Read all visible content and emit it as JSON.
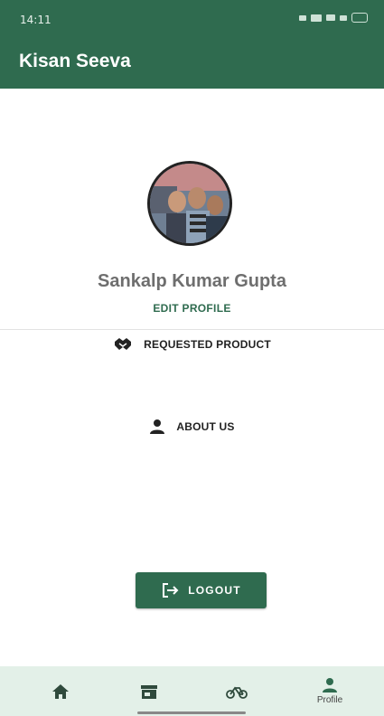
{
  "status_bar": {
    "time": "14:11"
  },
  "app_bar": {
    "title": "Kisan Seeva"
  },
  "profile": {
    "name": "Sankalp Kumar Gupta",
    "edit_label": "EDIT PROFILE"
  },
  "menu": [
    {
      "label": "REQUESTED PRODUCT",
      "icon": "handshake-icon"
    },
    {
      "label": "ABOUT US",
      "icon": "person-icon"
    }
  ],
  "logout": {
    "label": "LOGOUT",
    "icon": "logout-icon"
  },
  "bottom_nav": [
    {
      "icon": "home-icon",
      "label": ""
    },
    {
      "icon": "store-icon",
      "label": ""
    },
    {
      "icon": "bicycle-icon",
      "label": ""
    },
    {
      "icon": "person-icon",
      "label": "Profile",
      "active": true
    }
  ],
  "colors": {
    "primary": "#2f6b4f",
    "nav_bg": "#e3f0e8",
    "name_text": "#6e6e6e"
  }
}
